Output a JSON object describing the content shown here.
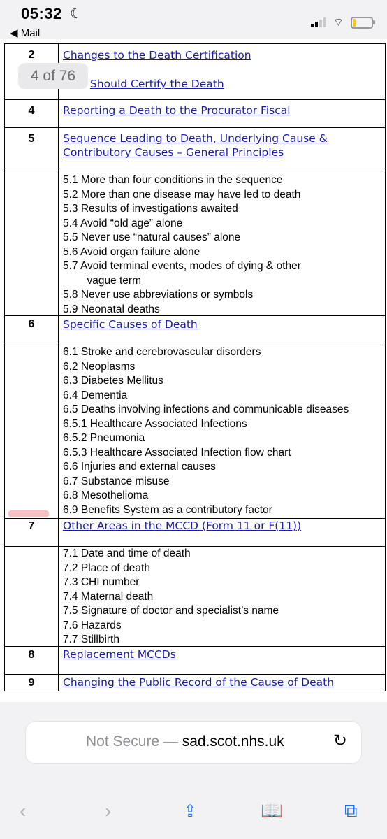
{
  "status_bar": {
    "time": "05:32",
    "back_app": "◀ Mail",
    "battery_color": "#f5c518"
  },
  "viewer": {
    "page_indicator": "4 of 76"
  },
  "contents": [
    {
      "number": "2",
      "title": "Changes to the Death Certification"
    },
    {
      "number": "",
      "title": "Should Certify the Death"
    },
    {
      "number": "4",
      "title": "Reporting a Death to the Procurator Fiscal"
    },
    {
      "number": "5",
      "title_line1": "Sequence Leading to Death, Underlying Cause &",
      "title_line2": "Contributory Causes – General Principles",
      "subitems": [
        "5.1 More than four conditions in the sequence",
        "5.2  More than one disease may have led to death",
        "5.3  Results of investigations awaited",
        "5.4  Avoid “old age” alone",
        "5.5  Never use “natural causes” alone",
        "5.6  Avoid organ failure alone",
        "5.7  Avoid terminal events, modes of dying & other",
        "        vague term",
        "5.8 Never use abbreviations or symbols",
        "5.9 Neonatal deaths"
      ]
    },
    {
      "number": "6",
      "title": "Specific Causes of Death",
      "subitems": [
        "6.1  Stroke and cerebrovascular disorders",
        "6.2  Neoplasms",
        "6.3  Diabetes Mellitus",
        "6.4  Dementia",
        "6.5  Deaths involving infections and communicable diseases",
        "6.5.1  Healthcare Associated Infections",
        "6.5.2  Pneumonia",
        "6.5.3  Healthcare Associated Infection flow chart",
        "6.6  Injuries and external causes",
        "6.7  Substance misuse",
        "6.8  Mesothelioma",
        "6.9  Benefits System as a contributory factor"
      ]
    },
    {
      "number": "7",
      "title": "Other Areas in the MCCD (Form 11 or F(11))",
      "subitems": [
        "7.1  Date and time of death",
        "7.2  Place of death",
        "7.3  CHI number",
        "7.4  Maternal death",
        "7.5  Signature of doctor and specialist’s name",
        "7.6  Hazards",
        "7.7  Stillbirth"
      ]
    },
    {
      "number": "8",
      "title": "Replacement MCCDs"
    },
    {
      "number": "9",
      "title": "Changing the Public Record of the Cause of Death"
    }
  ],
  "browser": {
    "not_secure": "Not Secure —",
    "domain": "sad.scot.nhs.uk",
    "link_color": "#1a1aa6"
  }
}
